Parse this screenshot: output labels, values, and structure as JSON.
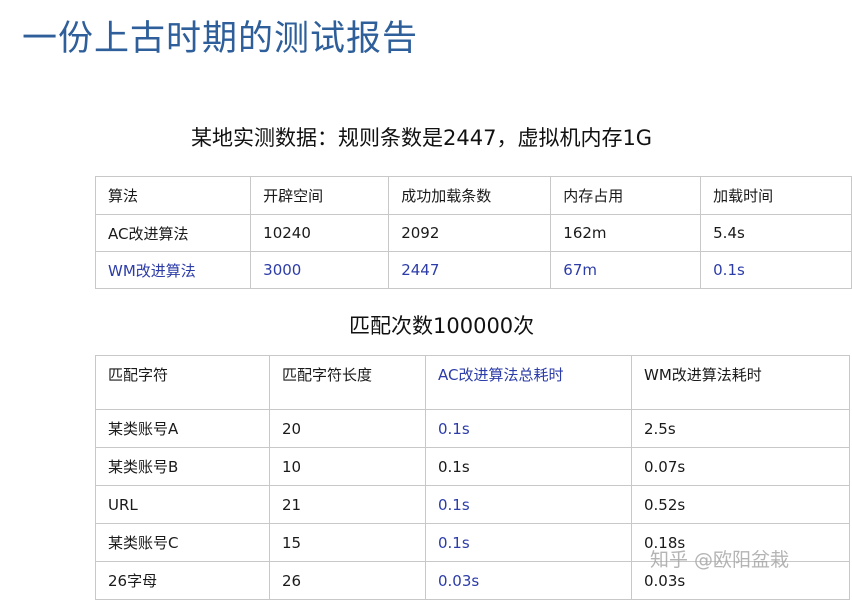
{
  "page_title": "一份上古时期的测试报告",
  "section1": {
    "title": "某地实测数据：规则条数是2447，虚拟机内存1G",
    "headers": [
      "算法",
      "开辟空间",
      "成功加载条数",
      "内存占用",
      "加载时间"
    ],
    "rows": [
      [
        "AC改进算法",
        "10240",
        "2092",
        "162m",
        "5.4s"
      ],
      [
        "WM改进算法",
        "3000",
        "2447",
        "67m",
        "0.1s"
      ]
    ]
  },
  "section2": {
    "title": "匹配次数100000次",
    "headers": [
      "匹配字符",
      "匹配字符长度",
      "AC改进算法总耗时",
      "WM改进算法耗时"
    ],
    "rows": [
      [
        "某类账号A",
        "20",
        "0.1s",
        "2.5s"
      ],
      [
        "某类账号B",
        "10",
        "0.1s",
        "0.07s"
      ],
      [
        "URL",
        "21",
        "0.1s",
        "0.52s"
      ],
      [
        "某类账号C",
        "15",
        "0.1s",
        "0.18s"
      ],
      [
        "26字母",
        "26",
        "0.03s",
        "0.03s"
      ]
    ]
  },
  "watermark": "知乎 @欧阳盆栽",
  "colors": {
    "title": "#2e5f9a",
    "highlight": "#2c3ca8"
  }
}
